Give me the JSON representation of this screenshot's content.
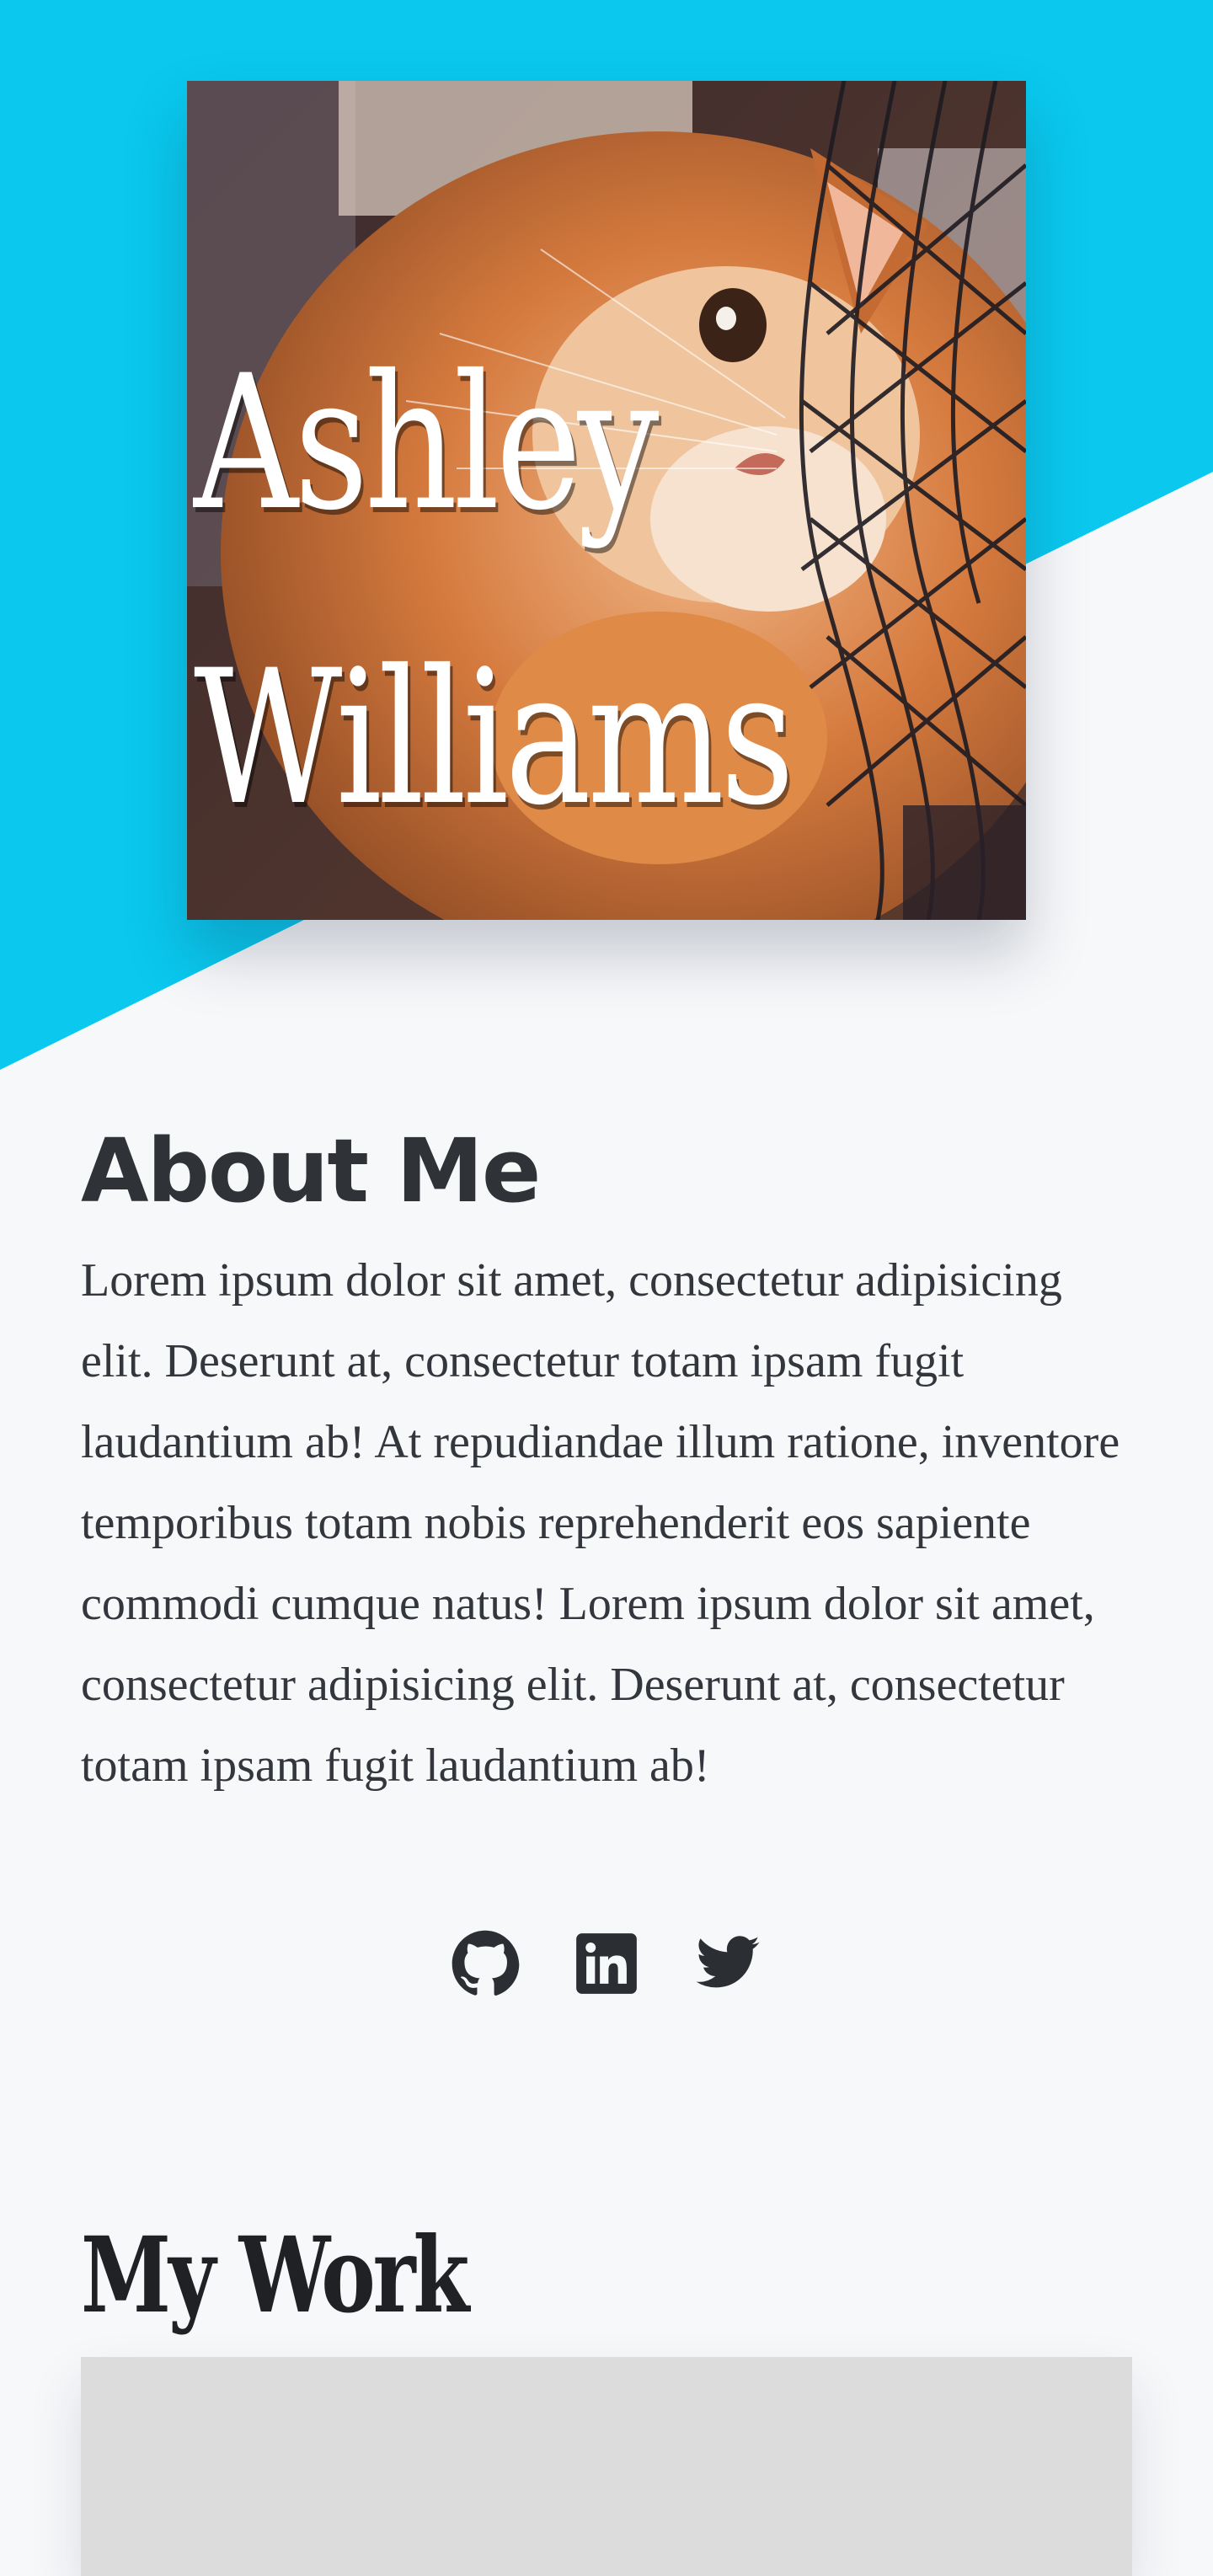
{
  "hero": {
    "first_name": "Ashley",
    "last_name": "Williams",
    "image_icon": "cat-photo"
  },
  "about": {
    "title": "About Me",
    "text": "Lorem ipsum dolor sit amet, consectetur adipisicing elit. Deserunt at, consectetur totam ipsam fugit laudantium ab! At repudiandae illum ratione, inventore temporibus totam nobis reprehenderit eos sapiente commodi cumque natus! Lorem ipsum dolor sit amet, consectetur adipisicing elit. Deserunt at, consectetur totam ipsam fugit laudantium ab!"
  },
  "social": [
    {
      "icon": "github-icon"
    },
    {
      "icon": "linkedin-icon"
    },
    {
      "icon": "twitter-icon"
    }
  ],
  "work": {
    "title": "My Work"
  },
  "colors": {
    "accent": "#0ac8ee",
    "background": "#f7f8fa",
    "text": "#333740",
    "placeholder": "#dcdcdc"
  }
}
